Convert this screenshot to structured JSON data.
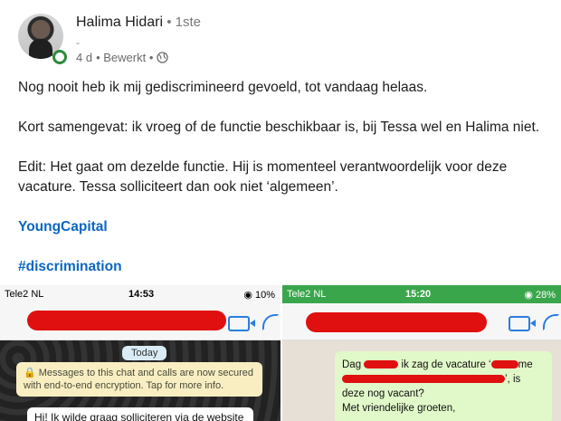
{
  "post": {
    "author_name": "Halima Hidari",
    "degree": " • 1ste",
    "headline": "-",
    "time": "4 d",
    "edited": "• Bewerkt •",
    "paragraphs": [
      "Nog nooit heb ik mij gediscrimineerd gevoeld, tot vandaag helaas.",
      "Kort samengevat: ik vroeg of de functie beschikbaar is, bij Tessa wel en Halima niet.",
      "Edit: Het gaat om dezelde functie. Hij is momenteel verantwoordelijk voor deze vacature. Tessa solliciteert dan ook niet ‘algemeen’."
    ],
    "link_company": "YoungCapital",
    "hashtag": "#discrimination"
  },
  "screenshot_left": {
    "carrier": "Tele2 NL",
    "time": "14:53",
    "battery": "◉ 10%",
    "today_label": "Today",
    "encryption_note": "🔒 Messages to this chat and calls are now secured with end-to-end encryption. Tap for more info.",
    "message": "Hi! Ik wilde graag solliciteren via de website"
  },
  "screenshot_right": {
    "carrier": "Tele2 NL",
    "time": "15:20",
    "battery": "◉ 28%",
    "msg_line1a": "Dag",
    "msg_line1b": "ik zag de vacature ‘",
    "msg_line1c": "me",
    "msg_line2": "’, is",
    "msg_line3": "deze nog vacant?",
    "msg_line4": "Met vriendelijke groeten,"
  },
  "colors": {
    "link": "#0a66c2",
    "whatsapp_green": "#3aa64b",
    "redaction": "#e01010"
  }
}
